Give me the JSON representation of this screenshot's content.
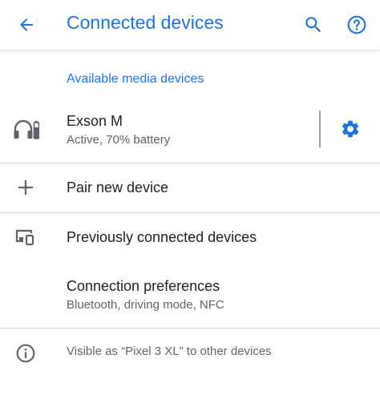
{
  "app_bar": {
    "title": "Connected devices",
    "back_icon": "arrow-back-icon",
    "search_icon": "search-icon",
    "help_icon": "help-icon"
  },
  "sections": {
    "available_media": "Available media devices"
  },
  "device": {
    "name": "Exson M",
    "status": "Active, 70% battery",
    "icon": "headset-battery-icon",
    "settings_icon": "gear-icon"
  },
  "pair_new": {
    "label": "Pair new device",
    "icon": "plus-icon"
  },
  "previously_connected": {
    "label": "Previously connected devices",
    "icon": "devices-icon"
  },
  "connection_preferences": {
    "label": "Connection preferences",
    "sub": "Bluetooth, driving mode, NFC"
  },
  "footer": {
    "text": "Visible as “Pixel 3 XL” to other devices",
    "icon": "info-icon"
  },
  "colors": {
    "accent": "#1a73e8",
    "text_primary": "#202124",
    "text_secondary": "#5f6368",
    "icon_gray": "#5f6368",
    "divider": "#dadce0"
  }
}
